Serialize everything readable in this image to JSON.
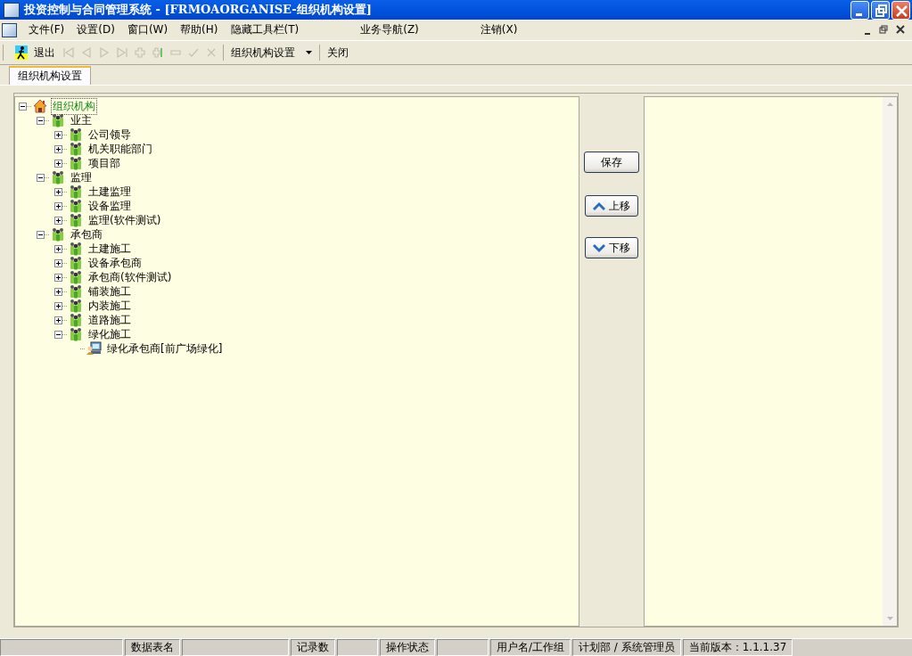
{
  "window": {
    "title": "投资控制与合同管理系统 - [FRMOAORGANISE-组织机构设置]"
  },
  "menu": [
    "文件(F)",
    "设置(D)",
    "窗口(W)",
    "帮助(H)",
    "隐藏工具栏(T)",
    "业务导航(Z)",
    "注销(X)"
  ],
  "toolbar": {
    "exit_label": "退出",
    "nav_buttons": [
      {
        "kind": "first",
        "disabled": true
      },
      {
        "kind": "prev",
        "disabled": true
      },
      {
        "kind": "next",
        "disabled": true
      },
      {
        "kind": "last",
        "disabled": true
      },
      {
        "kind": "add",
        "disabled": true
      },
      {
        "kind": "insert",
        "disabled": true
      },
      {
        "kind": "delete",
        "disabled": true
      },
      {
        "kind": "confirm",
        "disabled": true
      },
      {
        "kind": "cancel",
        "disabled": true
      }
    ],
    "dropdown_label": "组织机构设置",
    "close_label": "关闭"
  },
  "tabs": [
    {
      "label": "组织机构设置",
      "selected": true
    }
  ],
  "tree": {
    "label": "组织机构",
    "kind": "root",
    "expanded": true,
    "selected": true,
    "children": [
      {
        "label": "业主",
        "kind": "group",
        "expanded": true,
        "selected": false,
        "children": [
          {
            "label": "公司领导",
            "kind": "group",
            "expanded": false,
            "selected": false
          },
          {
            "label": "机关职能部门",
            "kind": "group",
            "expanded": false,
            "selected": false
          },
          {
            "label": "项目部",
            "kind": "group",
            "expanded": false,
            "selected": false
          }
        ]
      },
      {
        "label": "监理",
        "kind": "group",
        "expanded": true,
        "selected": false,
        "children": [
          {
            "label": "土建监理",
            "kind": "group",
            "expanded": false,
            "selected": false
          },
          {
            "label": "设备监理",
            "kind": "group",
            "expanded": false,
            "selected": false
          },
          {
            "label": "监理(软件测试)",
            "kind": "group",
            "expanded": false,
            "selected": false
          }
        ]
      },
      {
        "label": "承包商",
        "kind": "group",
        "expanded": true,
        "selected": false,
        "children": [
          {
            "label": "土建施工",
            "kind": "group",
            "expanded": false,
            "selected": false
          },
          {
            "label": "设备承包商",
            "kind": "group",
            "expanded": false,
            "selected": false
          },
          {
            "label": "承包商(软件测试)",
            "kind": "group",
            "expanded": false,
            "selected": false
          },
          {
            "label": "铺装施工",
            "kind": "group",
            "expanded": false,
            "selected": false
          },
          {
            "label": "内装施工",
            "kind": "group",
            "expanded": false,
            "selected": false
          },
          {
            "label": "道路施工",
            "kind": "group",
            "expanded": false,
            "selected": false
          },
          {
            "label": "绿化施工",
            "kind": "group",
            "expanded": true,
            "selected": false,
            "children": [
              {
                "label": "绿化承包商[前广场绿化]",
                "kind": "member",
                "selected": false
              }
            ]
          }
        ]
      }
    ]
  },
  "buttons": [
    {
      "label": "保存",
      "kind": "plain"
    },
    {
      "label": "上移",
      "kind": "up"
    },
    {
      "label": "下移",
      "kind": "down"
    }
  ],
  "status_bar": [
    {
      "label": "数据表名"
    },
    {
      "label": "记录数"
    },
    {
      "label": "操作状态"
    },
    {
      "label": "用户名/工作组",
      "value": "计划部 / 系统管理员"
    },
    {
      "label": "当前版本：1.1.1.37"
    }
  ]
}
